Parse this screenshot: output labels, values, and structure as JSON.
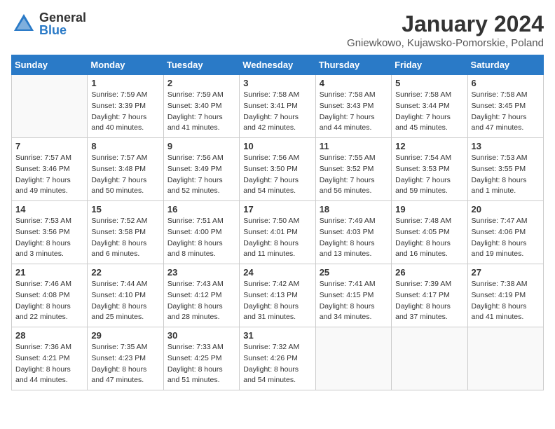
{
  "header": {
    "logo_general": "General",
    "logo_blue": "Blue",
    "month_year": "January 2024",
    "location": "Gniewkowo, Kujawsko-Pomorskie, Poland"
  },
  "days_of_week": [
    "Sunday",
    "Monday",
    "Tuesday",
    "Wednesday",
    "Thursday",
    "Friday",
    "Saturday"
  ],
  "weeks": [
    [
      {
        "day": "",
        "sunrise": "",
        "sunset": "",
        "daylight": ""
      },
      {
        "day": "1",
        "sunrise": "Sunrise: 7:59 AM",
        "sunset": "Sunset: 3:39 PM",
        "daylight": "Daylight: 7 hours and 40 minutes."
      },
      {
        "day": "2",
        "sunrise": "Sunrise: 7:59 AM",
        "sunset": "Sunset: 3:40 PM",
        "daylight": "Daylight: 7 hours and 41 minutes."
      },
      {
        "day": "3",
        "sunrise": "Sunrise: 7:58 AM",
        "sunset": "Sunset: 3:41 PM",
        "daylight": "Daylight: 7 hours and 42 minutes."
      },
      {
        "day": "4",
        "sunrise": "Sunrise: 7:58 AM",
        "sunset": "Sunset: 3:43 PM",
        "daylight": "Daylight: 7 hours and 44 minutes."
      },
      {
        "day": "5",
        "sunrise": "Sunrise: 7:58 AM",
        "sunset": "Sunset: 3:44 PM",
        "daylight": "Daylight: 7 hours and 45 minutes."
      },
      {
        "day": "6",
        "sunrise": "Sunrise: 7:58 AM",
        "sunset": "Sunset: 3:45 PM",
        "daylight": "Daylight: 7 hours and 47 minutes."
      }
    ],
    [
      {
        "day": "7",
        "sunrise": "Sunrise: 7:57 AM",
        "sunset": "Sunset: 3:46 PM",
        "daylight": "Daylight: 7 hours and 49 minutes."
      },
      {
        "day": "8",
        "sunrise": "Sunrise: 7:57 AM",
        "sunset": "Sunset: 3:48 PM",
        "daylight": "Daylight: 7 hours and 50 minutes."
      },
      {
        "day": "9",
        "sunrise": "Sunrise: 7:56 AM",
        "sunset": "Sunset: 3:49 PM",
        "daylight": "Daylight: 7 hours and 52 minutes."
      },
      {
        "day": "10",
        "sunrise": "Sunrise: 7:56 AM",
        "sunset": "Sunset: 3:50 PM",
        "daylight": "Daylight: 7 hours and 54 minutes."
      },
      {
        "day": "11",
        "sunrise": "Sunrise: 7:55 AM",
        "sunset": "Sunset: 3:52 PM",
        "daylight": "Daylight: 7 hours and 56 minutes."
      },
      {
        "day": "12",
        "sunrise": "Sunrise: 7:54 AM",
        "sunset": "Sunset: 3:53 PM",
        "daylight": "Daylight: 7 hours and 59 minutes."
      },
      {
        "day": "13",
        "sunrise": "Sunrise: 7:53 AM",
        "sunset": "Sunset: 3:55 PM",
        "daylight": "Daylight: 8 hours and 1 minute."
      }
    ],
    [
      {
        "day": "14",
        "sunrise": "Sunrise: 7:53 AM",
        "sunset": "Sunset: 3:56 PM",
        "daylight": "Daylight: 8 hours and 3 minutes."
      },
      {
        "day": "15",
        "sunrise": "Sunrise: 7:52 AM",
        "sunset": "Sunset: 3:58 PM",
        "daylight": "Daylight: 8 hours and 6 minutes."
      },
      {
        "day": "16",
        "sunrise": "Sunrise: 7:51 AM",
        "sunset": "Sunset: 4:00 PM",
        "daylight": "Daylight: 8 hours and 8 minutes."
      },
      {
        "day": "17",
        "sunrise": "Sunrise: 7:50 AM",
        "sunset": "Sunset: 4:01 PM",
        "daylight": "Daylight: 8 hours and 11 minutes."
      },
      {
        "day": "18",
        "sunrise": "Sunrise: 7:49 AM",
        "sunset": "Sunset: 4:03 PM",
        "daylight": "Daylight: 8 hours and 13 minutes."
      },
      {
        "day": "19",
        "sunrise": "Sunrise: 7:48 AM",
        "sunset": "Sunset: 4:05 PM",
        "daylight": "Daylight: 8 hours and 16 minutes."
      },
      {
        "day": "20",
        "sunrise": "Sunrise: 7:47 AM",
        "sunset": "Sunset: 4:06 PM",
        "daylight": "Daylight: 8 hours and 19 minutes."
      }
    ],
    [
      {
        "day": "21",
        "sunrise": "Sunrise: 7:46 AM",
        "sunset": "Sunset: 4:08 PM",
        "daylight": "Daylight: 8 hours and 22 minutes."
      },
      {
        "day": "22",
        "sunrise": "Sunrise: 7:44 AM",
        "sunset": "Sunset: 4:10 PM",
        "daylight": "Daylight: 8 hours and 25 minutes."
      },
      {
        "day": "23",
        "sunrise": "Sunrise: 7:43 AM",
        "sunset": "Sunset: 4:12 PM",
        "daylight": "Daylight: 8 hours and 28 minutes."
      },
      {
        "day": "24",
        "sunrise": "Sunrise: 7:42 AM",
        "sunset": "Sunset: 4:13 PM",
        "daylight": "Daylight: 8 hours and 31 minutes."
      },
      {
        "day": "25",
        "sunrise": "Sunrise: 7:41 AM",
        "sunset": "Sunset: 4:15 PM",
        "daylight": "Daylight: 8 hours and 34 minutes."
      },
      {
        "day": "26",
        "sunrise": "Sunrise: 7:39 AM",
        "sunset": "Sunset: 4:17 PM",
        "daylight": "Daylight: 8 hours and 37 minutes."
      },
      {
        "day": "27",
        "sunrise": "Sunrise: 7:38 AM",
        "sunset": "Sunset: 4:19 PM",
        "daylight": "Daylight: 8 hours and 41 minutes."
      }
    ],
    [
      {
        "day": "28",
        "sunrise": "Sunrise: 7:36 AM",
        "sunset": "Sunset: 4:21 PM",
        "daylight": "Daylight: 8 hours and 44 minutes."
      },
      {
        "day": "29",
        "sunrise": "Sunrise: 7:35 AM",
        "sunset": "Sunset: 4:23 PM",
        "daylight": "Daylight: 8 hours and 47 minutes."
      },
      {
        "day": "30",
        "sunrise": "Sunrise: 7:33 AM",
        "sunset": "Sunset: 4:25 PM",
        "daylight": "Daylight: 8 hours and 51 minutes."
      },
      {
        "day": "31",
        "sunrise": "Sunrise: 7:32 AM",
        "sunset": "Sunset: 4:26 PM",
        "daylight": "Daylight: 8 hours and 54 minutes."
      },
      {
        "day": "",
        "sunrise": "",
        "sunset": "",
        "daylight": ""
      },
      {
        "day": "",
        "sunrise": "",
        "sunset": "",
        "daylight": ""
      },
      {
        "day": "",
        "sunrise": "",
        "sunset": "",
        "daylight": ""
      }
    ]
  ]
}
